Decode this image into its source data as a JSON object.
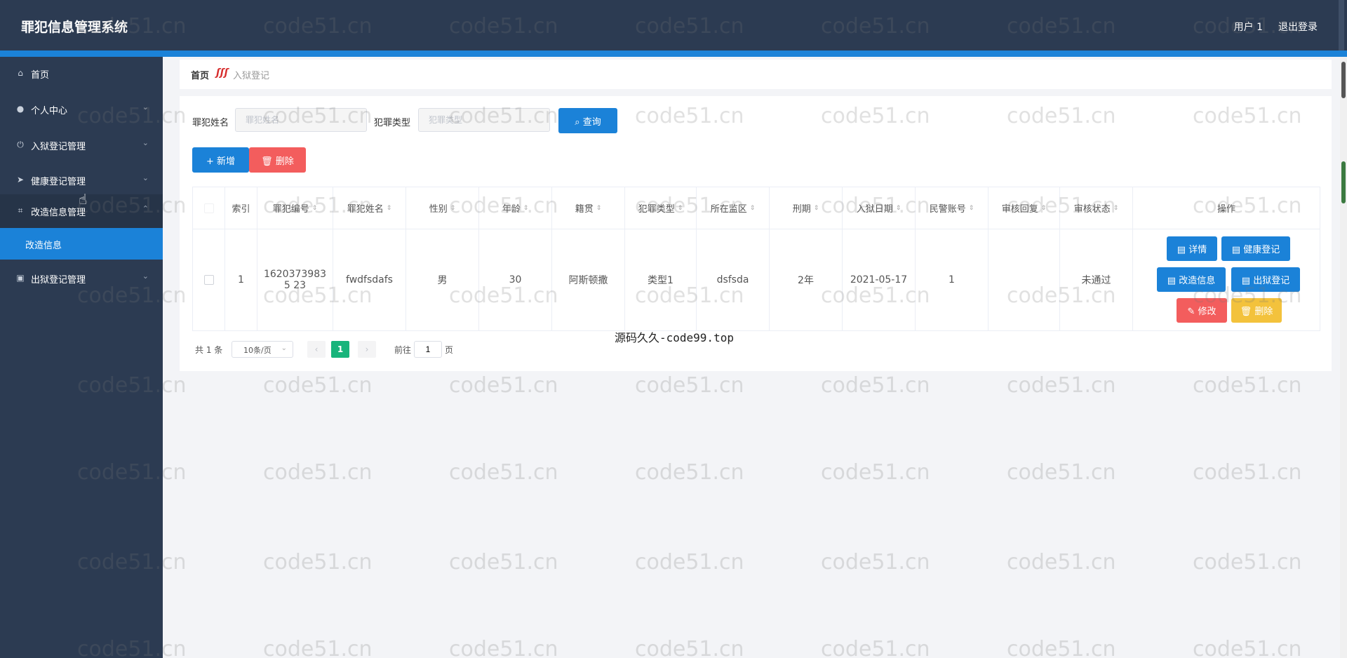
{
  "header": {
    "title": "罪犯信息管理系统",
    "user": "用户 1",
    "logout": "退出登录"
  },
  "sidebar": {
    "items": [
      {
        "label": "首页",
        "icon": "home-icon"
      },
      {
        "label": "个人中心",
        "icon": "user-icon"
      },
      {
        "label": "入狱登记管理",
        "icon": "power-icon"
      },
      {
        "label": "健康登记管理",
        "icon": "send-icon"
      },
      {
        "label": "改造信息管理",
        "icon": "crop-icon"
      },
      {
        "label": "改造信息",
        "icon": ""
      },
      {
        "label": "出狱登记管理",
        "icon": "clipboard-icon"
      }
    ]
  },
  "breadcrumb": {
    "home": "首页",
    "current": "入狱登记"
  },
  "search": {
    "name_label": "罪犯姓名",
    "name_placeholder": "罪犯姓名",
    "type_label": "犯罪类型",
    "type_placeholder": "犯罪类型",
    "query": "查询"
  },
  "toolbar": {
    "add": "新增",
    "delete": "删除"
  },
  "table": {
    "columns": [
      "索引",
      "罪犯编号",
      "罪犯姓名",
      "性别",
      "年龄",
      "籍贯",
      "犯罪类型",
      "所在监区",
      "刑期",
      "入狱日期",
      "民警账号",
      "审核回复",
      "审核状态",
      "操作"
    ],
    "rows": [
      {
        "index": "1",
        "code": "16203739835 23",
        "name": "fwdfsdafs",
        "gender": "男",
        "age": "30",
        "origin": "阿斯顿撒",
        "crime_type": "类型1",
        "area": "dsfsda",
        "term": "2年",
        "date": "2021-05-17",
        "police": "1",
        "reply": "",
        "status": "未通过"
      }
    ],
    "actions": {
      "detail": "详情",
      "health": "健康登记",
      "reform": "改造信息",
      "release": "出狱登记",
      "edit": "修改",
      "delete": "删除"
    }
  },
  "pagination": {
    "total": "共 1 条",
    "page_size": "10条/页",
    "current": "1",
    "goto": "前往",
    "goto_value": "1",
    "page_unit": "页"
  },
  "overlay_text": "源码久久-code99.top",
  "watermark": "code51.cn"
}
